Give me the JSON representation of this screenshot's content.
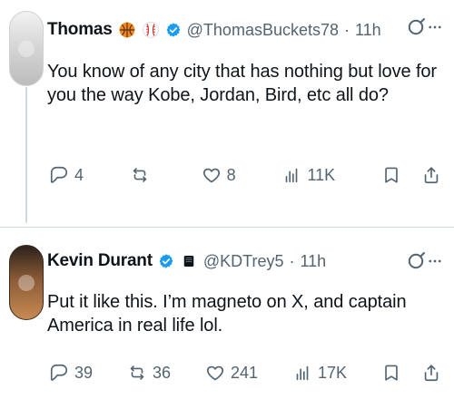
{
  "tweets": [
    {
      "author": {
        "display_name": "Thomas",
        "handle": "@ThomasBuckets78",
        "time": "11h",
        "badges": [
          "basketball",
          "baseball"
        ],
        "verified": true
      },
      "text": "You know of any city that has nothing but love for you the way Kobe, Jordan, Bird, etc all do?",
      "metrics": {
        "replies": "4",
        "reposts": "",
        "likes": "8",
        "views": "11K"
      }
    },
    {
      "author": {
        "display_name": "Kevin Durant",
        "handle": "@KDTrey5",
        "time": "11h",
        "badges": [
          "square-badge"
        ],
        "verified": true
      },
      "text": "Put it like this. I’m magneto on X, and captain America in real life lol.",
      "metrics": {
        "replies": "39",
        "reposts": "36",
        "likes": "241",
        "views": "17K"
      }
    }
  ],
  "separator": "·",
  "icons": {
    "verified": "verified-badge-icon",
    "grok": "grok-icon",
    "more": "more-icon",
    "reply": "reply-icon",
    "repost": "repost-icon",
    "like": "like-icon",
    "views": "views-icon",
    "bookmark": "bookmark-icon",
    "share": "share-icon"
  },
  "colors": {
    "text": "#0f1419",
    "secondary": "#536471",
    "verified_blue": "#1d9bf0",
    "divider": "#cfd9de",
    "background": "#ffffff"
  }
}
